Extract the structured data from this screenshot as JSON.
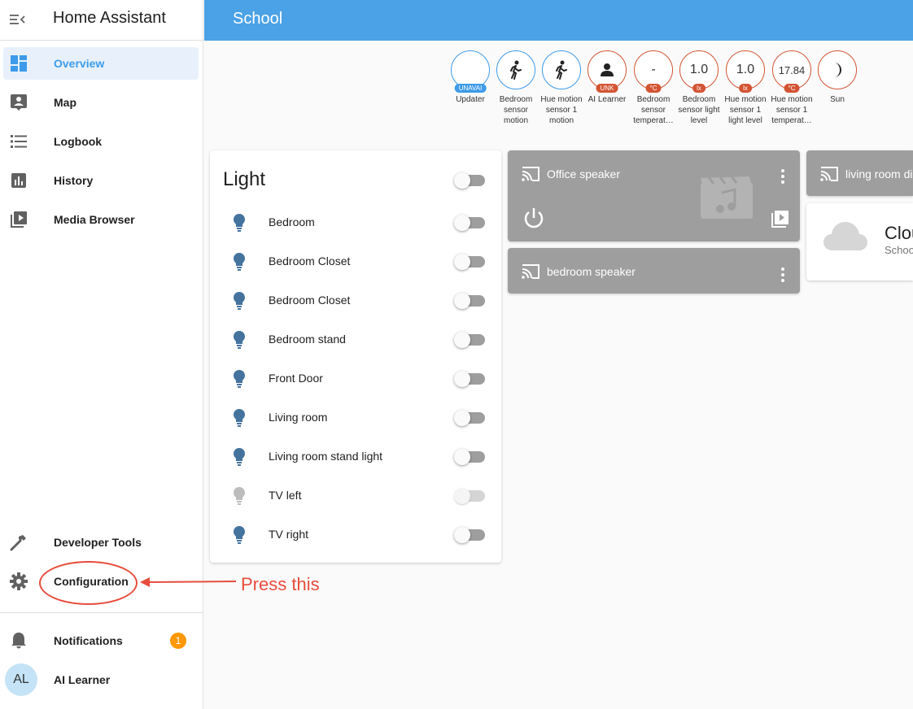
{
  "sidebar": {
    "title": "Home Assistant",
    "items": [
      {
        "label": "Overview",
        "icon": "view-dashboard-icon",
        "selected": true
      },
      {
        "label": "Map",
        "icon": "map-account-icon"
      },
      {
        "label": "Logbook",
        "icon": "list-icon"
      },
      {
        "label": "History",
        "icon": "chart-bar-icon"
      },
      {
        "label": "Media Browser",
        "icon": "play-box-icon"
      }
    ],
    "bottom_items": [
      {
        "label": "Developer Tools",
        "icon": "hammer-icon"
      },
      {
        "label": "Configuration",
        "icon": "cog-icon"
      }
    ],
    "notifications": {
      "label": "Notifications",
      "count": "1"
    },
    "user": {
      "initials": "AL",
      "name": "AI Learner"
    }
  },
  "header": {
    "title": "School"
  },
  "badges": [
    {
      "value": "",
      "pill": "UNAVAI",
      "caption": "Updater"
    },
    {
      "value": "",
      "pill": "",
      "caption": "Bedroom sensor motion"
    },
    {
      "value": "",
      "pill": "",
      "caption": "Hue motion sensor 1 motion"
    },
    {
      "value": "",
      "pill": "UNK",
      "caption": "AI Learner"
    },
    {
      "value": "-",
      "pill": "°C",
      "caption": "Bedroom sensor temperat…"
    },
    {
      "value": "1.0",
      "pill": "lx",
      "caption": "Bedroom sensor light level"
    },
    {
      "value": "1.0",
      "pill": "lx",
      "caption": "Hue motion sensor 1 light level"
    },
    {
      "value": "17.84",
      "pill": "°C",
      "caption": "Hue motion sensor 1 temperat…"
    },
    {
      "value": "",
      "pill": "",
      "caption": "Sun"
    }
  ],
  "light_card": {
    "title": "Light",
    "entities": [
      {
        "name": "Bedroom"
      },
      {
        "name": "Bedroom Closet"
      },
      {
        "name": "Bedroom Closet"
      },
      {
        "name": "Bedroom stand"
      },
      {
        "name": "Front Door"
      },
      {
        "name": "Living room"
      },
      {
        "name": "Living room stand light"
      },
      {
        "name": "TV left",
        "unavailable": true
      },
      {
        "name": "TV right"
      }
    ]
  },
  "media": {
    "office": {
      "name": "Office speaker"
    },
    "bedroom": {
      "name": "bedroom speaker"
    },
    "living": {
      "name": "living room di"
    }
  },
  "weather": {
    "condition": "Clou",
    "location": "Schoo"
  },
  "annotation": {
    "text": "Press this"
  },
  "colors": {
    "accent": "#3d9be9",
    "header": "#4ba2e6",
    "annotation": "#e74c3c",
    "media_bg": "#9e9e9e",
    "bulb": "#44739e"
  }
}
